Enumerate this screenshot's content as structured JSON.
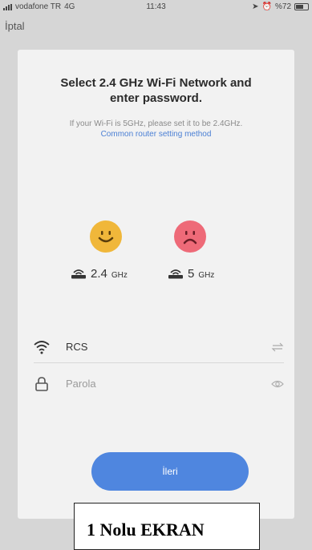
{
  "status_bar": {
    "carrier": "vodafone TR",
    "network": "4G",
    "time": "11:43",
    "battery": "%72"
  },
  "nav": {
    "back_label": "İptal"
  },
  "main": {
    "title": "Select 2.4 GHz Wi-Fi Network and enter password.",
    "subtitle": "If your Wi-Fi is 5GHz, please set it to be 2.4GHz.",
    "link": "Common router setting method",
    "bands": [
      {
        "value": "2.4",
        "unit": "GHz",
        "status": "ok",
        "color": "#f0b73a"
      },
      {
        "value": "5",
        "unit": "GHz",
        "status": "not-supported",
        "color": "#ee6a78"
      }
    ],
    "ssid": {
      "value": "RCS"
    },
    "password": {
      "placeholder": "Parola"
    },
    "next_label": "İleri",
    "accent_color": "#4f86df"
  },
  "overlay_label": "1 Nolu EKRAN"
}
